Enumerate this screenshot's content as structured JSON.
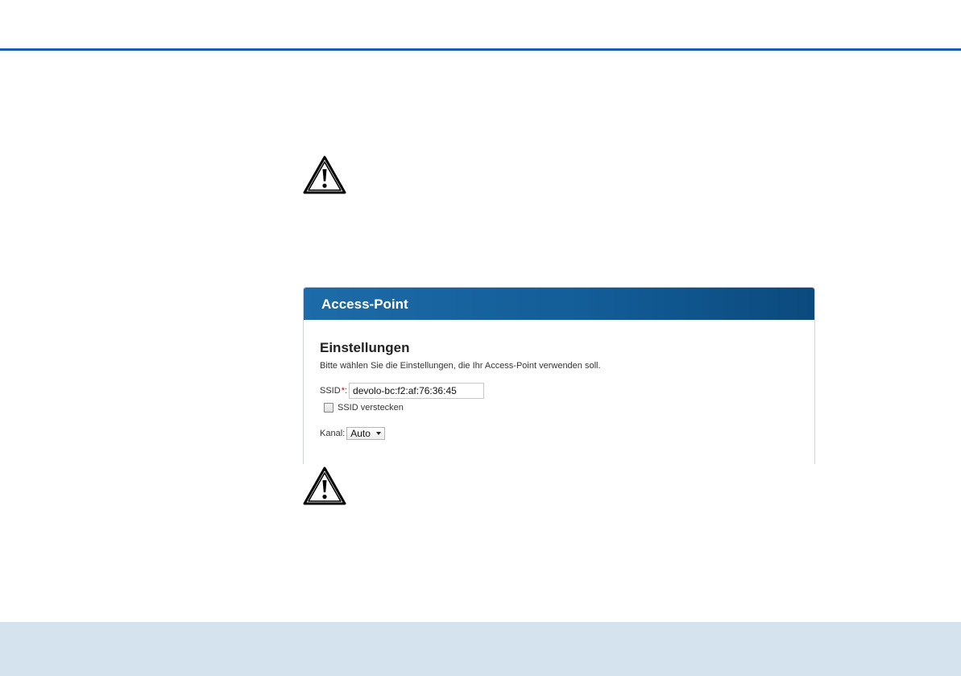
{
  "panel": {
    "title": "Access-Point",
    "section_title": "Einstellungen",
    "description": "Bitte wählen Sie die Einstellungen, die Ihr Access-Point verwenden soll.",
    "ssid_label": "SSID",
    "required_marker": "*:",
    "ssid_value": "devolo-bc:f2:af:76:36:45",
    "hide_ssid_label": "SSID verstecken",
    "hide_ssid_checked": false,
    "channel_label": "Kanal:",
    "channel_value": "Auto"
  },
  "icons": {
    "warning_top": "warning-triangle-icon",
    "warning_bottom": "warning-triangle-icon"
  },
  "colors": {
    "header_rule": "#1a5fb4",
    "panel_header": "#135d98",
    "footer_band": "#d5e3ee",
    "required": "#cc0000"
  }
}
